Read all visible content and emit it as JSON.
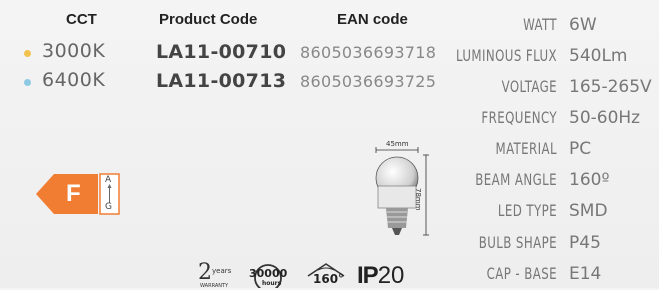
{
  "headers": {
    "cct": "CCT",
    "product_code": "Product Code",
    "ean": "EAN code"
  },
  "rows": [
    {
      "cct": "3000K",
      "dot_color": "#f2c14e",
      "code": "LA11-00710",
      "ean": "8605036693718"
    },
    {
      "cct": "6400K",
      "dot_color": "#8ec9e4",
      "code": "LA11-00713",
      "ean": "8605036693725"
    }
  ],
  "specs": [
    {
      "label": "WATT",
      "value": "6W"
    },
    {
      "label": "LUMINOUS FLUX",
      "value": "540Lm"
    },
    {
      "label": "VOLTAGE",
      "value": "165-265V"
    },
    {
      "label": "FREQUENCY",
      "value": "50-60Hz"
    },
    {
      "label": "MATERIAL",
      "value": "PC"
    },
    {
      "label": "BEAM ANGLE",
      "value": "160º"
    },
    {
      "label": "LED TYPE",
      "value": "SMD"
    },
    {
      "label": "BULB SHAPE",
      "value": "P45"
    },
    {
      "label": "CAP - BASE",
      "value": "E14"
    }
  ],
  "energy": {
    "class": "F",
    "scale_top": "A",
    "scale_bottom": "G",
    "color": "#f07d32"
  },
  "dimensions": {
    "width": "45mm",
    "height": "78mm"
  },
  "badges": {
    "warranty_number": "2",
    "warranty_unit": "years",
    "warranty_label": "WARRANTY",
    "hours_value": "30000",
    "hours_unit": "hours",
    "angle": "160°",
    "ip_prefix": "IP",
    "ip_value": "20"
  }
}
